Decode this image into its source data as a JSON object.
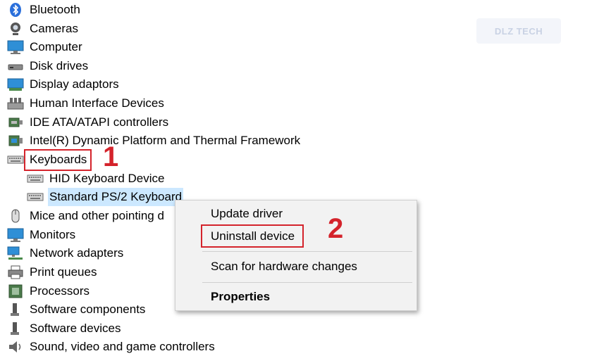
{
  "watermark": {
    "text": "DLZ TECH"
  },
  "tree": {
    "items": [
      {
        "label": "Bluetooth",
        "icon": "bluetooth-icon"
      },
      {
        "label": "Cameras",
        "icon": "camera-icon"
      },
      {
        "label": "Computer",
        "icon": "computer-icon"
      },
      {
        "label": "Disk drives",
        "icon": "disk-drive-icon"
      },
      {
        "label": "Display adaptors",
        "icon": "display-adapter-icon"
      },
      {
        "label": "Human Interface Devices",
        "icon": "hid-icon"
      },
      {
        "label": "IDE ATA/ATAPI controllers",
        "icon": "ide-controller-icon"
      },
      {
        "label": "Intel(R) Dynamic Platform and Thermal Framework",
        "icon": "chip-icon"
      },
      {
        "label": "Keyboards",
        "icon": "keyboard-icon"
      },
      {
        "label": "HID Keyboard Device",
        "icon": "keyboard-icon"
      },
      {
        "label": "Standard PS/2 Keyboard",
        "icon": "keyboard-icon"
      },
      {
        "label": "Mice and other pointing d",
        "icon": "mouse-icon"
      },
      {
        "label": "Monitors",
        "icon": "monitor-icon"
      },
      {
        "label": "Network adapters",
        "icon": "network-adapter-icon"
      },
      {
        "label": "Print queues",
        "icon": "printer-icon"
      },
      {
        "label": "Processors",
        "icon": "processor-icon"
      },
      {
        "label": "Software components",
        "icon": "software-component-icon"
      },
      {
        "label": "Software devices",
        "icon": "software-device-icon"
      },
      {
        "label": "Sound, video and game controllers",
        "icon": "sound-icon"
      }
    ]
  },
  "annotations": {
    "step1": "1",
    "step2": "2"
  },
  "context_menu": {
    "update_driver": "Update driver",
    "uninstall_device": "Uninstall device",
    "scan_hardware": "Scan for hardware changes",
    "properties": "Properties"
  },
  "colors": {
    "annotation_red": "#d4232b",
    "selection": "#cce8ff",
    "menu_bg": "#f2f2f2"
  }
}
